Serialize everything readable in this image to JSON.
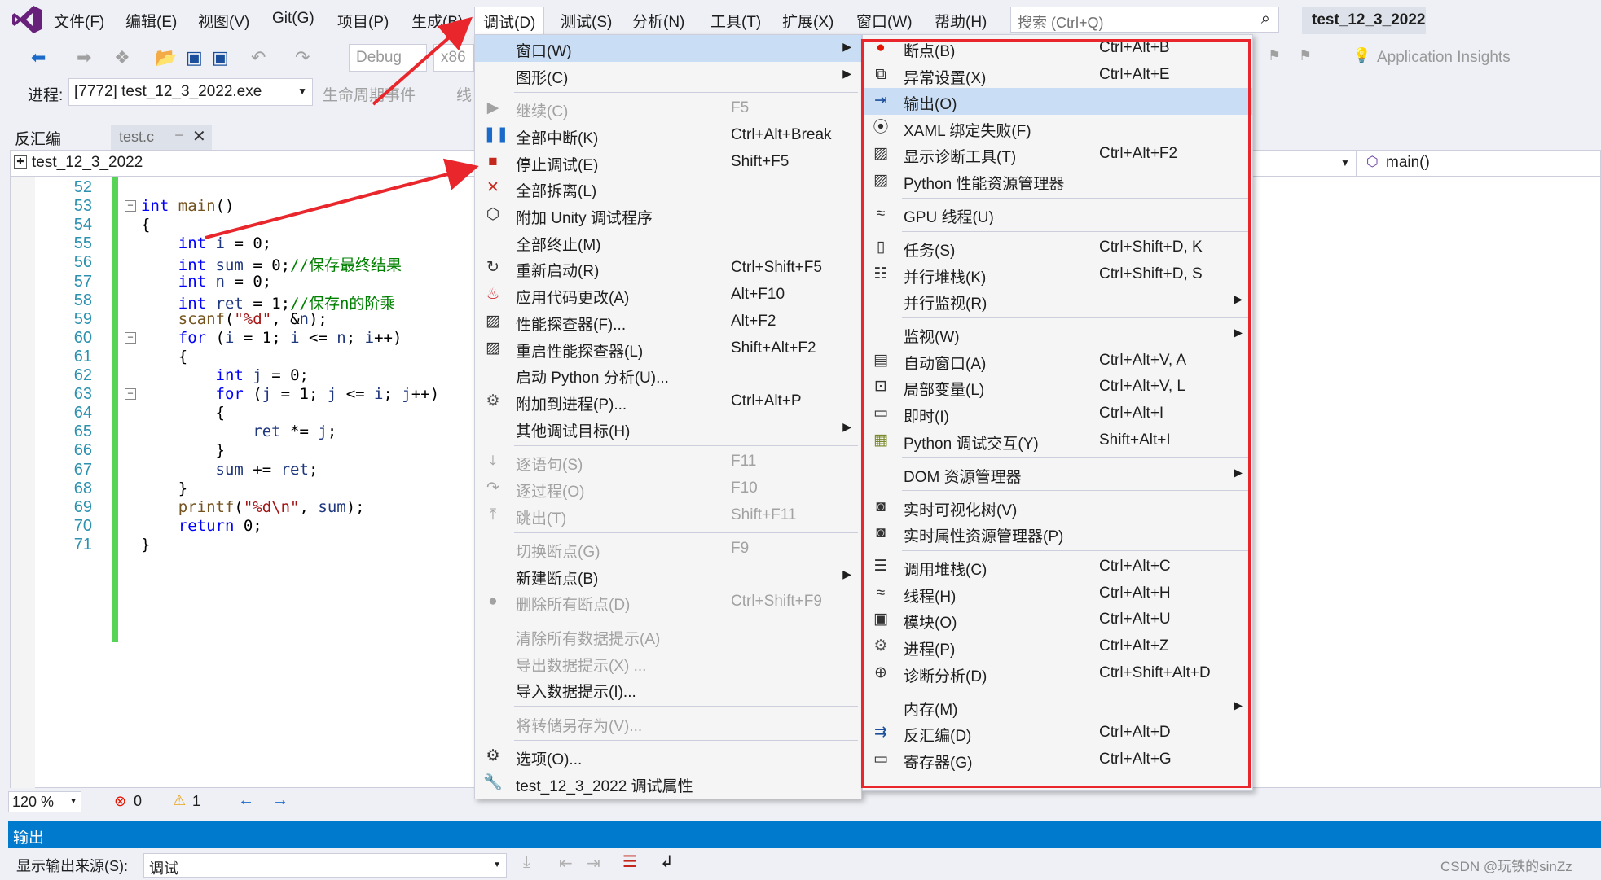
{
  "menubar": {
    "items": [
      "文件(F)",
      "编辑(E)",
      "视图(V)",
      "Git(G)",
      "项目(P)",
      "生成(B)",
      "调试(D)",
      "测试(S)",
      "分析(N)",
      "工具(T)",
      "扩展(X)",
      "窗口(W)",
      "帮助(H)"
    ],
    "search_placeholder": "搜索 (Ctrl+Q)",
    "solution_title": "test_12_3_2022"
  },
  "toolbar": {
    "config": "Debug",
    "platform": "x86",
    "insights": "Application Insights",
    "process_label": "进程:",
    "process_value": "[7772] test_12_3_2022.exe",
    "lifecycle": "生命周期事件",
    "thread": "线"
  },
  "tabs": {
    "disasm": "反汇编",
    "file": "test.c"
  },
  "navbar": {
    "project": "test_12_3_2022",
    "scope": "main()"
  },
  "code": [
    {
      "n": "52",
      "t": ""
    },
    {
      "n": "53",
      "t": "int main()"
    },
    {
      "n": "54",
      "t": "{"
    },
    {
      "n": "55",
      "t": "    int i = 0;"
    },
    {
      "n": "56",
      "t": "    int sum = 0;//保存最终结果"
    },
    {
      "n": "57",
      "t": "    int n = 0;"
    },
    {
      "n": "58",
      "t": "    int ret = 1;//保存n的阶乘"
    },
    {
      "n": "59",
      "t": "    scanf(\"%d\", &n);"
    },
    {
      "n": "60",
      "t": "    for (i = 1; i <= n; i++)"
    },
    {
      "n": "61",
      "t": "    {"
    },
    {
      "n": "62",
      "t": "        int j = 0;"
    },
    {
      "n": "63",
      "t": "        for (j = 1; j <= i; j++)"
    },
    {
      "n": "64",
      "t": "        {"
    },
    {
      "n": "65",
      "t": "            ret *= j;"
    },
    {
      "n": "66",
      "t": "        }"
    },
    {
      "n": "67",
      "t": "        sum += ret;"
    },
    {
      "n": "68",
      "t": "    }"
    },
    {
      "n": "69",
      "t": "    printf(\"%d\\n\", sum);"
    },
    {
      "n": "70",
      "t": "    return 0;"
    },
    {
      "n": "71",
      "t": "}"
    }
  ],
  "debug_menu": [
    {
      "icon": "",
      "label": "窗口(W)",
      "shortcut": "",
      "sub": true,
      "hl": true
    },
    {
      "icon": "",
      "label": "图形(C)",
      "shortcut": "",
      "sub": true
    },
    {
      "sep": true
    },
    {
      "icon": "play-icon",
      "label": "继续(C)",
      "shortcut": "F5",
      "dis": true
    },
    {
      "icon": "pause-icon",
      "label": "全部中断(K)",
      "shortcut": "Ctrl+Alt+Break"
    },
    {
      "icon": "stop-icon",
      "label": "停止调试(E)",
      "shortcut": "Shift+F5"
    },
    {
      "icon": "close-icon",
      "label": "全部拆离(L)",
      "shortcut": ""
    },
    {
      "icon": "unity-icon",
      "label": "附加 Unity 调试程序",
      "shortcut": ""
    },
    {
      "icon": "",
      "label": "全部终止(M)",
      "shortcut": ""
    },
    {
      "icon": "restart-icon",
      "label": "重新启动(R)",
      "shortcut": "Ctrl+Shift+F5"
    },
    {
      "icon": "fire-icon",
      "label": "应用代码更改(A)",
      "shortcut": "Alt+F10"
    },
    {
      "icon": "profiler-icon",
      "label": "性能探查器(F)...",
      "shortcut": "Alt+F2"
    },
    {
      "icon": "profiler-icon",
      "label": "重启性能探查器(L)",
      "shortcut": "Shift+Alt+F2"
    },
    {
      "icon": "",
      "label": "启动 Python 分析(U)...",
      "shortcut": ""
    },
    {
      "icon": "gears-icon",
      "label": "附加到进程(P)...",
      "shortcut": "Ctrl+Alt+P"
    },
    {
      "icon": "",
      "label": "其他调试目标(H)",
      "shortcut": "",
      "sub": true
    },
    {
      "sep": true
    },
    {
      "icon": "step-into-icon",
      "label": "逐语句(S)",
      "shortcut": "F11",
      "dis": true
    },
    {
      "icon": "step-over-icon",
      "label": "逐过程(O)",
      "shortcut": "F10",
      "dis": true
    },
    {
      "icon": "step-out-icon",
      "label": "跳出(T)",
      "shortcut": "Shift+F11",
      "dis": true
    },
    {
      "sep": true
    },
    {
      "icon": "",
      "label": "切换断点(G)",
      "shortcut": "F9",
      "dis": true
    },
    {
      "icon": "",
      "label": "新建断点(B)",
      "shortcut": "",
      "sub": true
    },
    {
      "icon": "breakpoints-icon",
      "label": "删除所有断点(D)",
      "shortcut": "Ctrl+Shift+F9",
      "dis": true
    },
    {
      "sep": true
    },
    {
      "icon": "",
      "label": "清除所有数据提示(A)",
      "shortcut": "",
      "dis": true
    },
    {
      "icon": "",
      "label": "导出数据提示(X) ...",
      "shortcut": "",
      "dis": true
    },
    {
      "icon": "",
      "label": "导入数据提示(I)...",
      "shortcut": ""
    },
    {
      "sep": true
    },
    {
      "icon": "",
      "label": "将转储另存为(V)...",
      "shortcut": "",
      "dis": true
    },
    {
      "sep": true
    },
    {
      "icon": "gear-icon",
      "label": "选项(O)...",
      "shortcut": ""
    },
    {
      "icon": "wrench-icon",
      "label": "test_12_3_2022 调试属性",
      "shortcut": ""
    }
  ],
  "window_menu": [
    {
      "icon": "breakpoint-icon",
      "label": "断点(B)",
      "shortcut": "Ctrl+Alt+B"
    },
    {
      "icon": "exception-icon",
      "label": "异常设置(X)",
      "shortcut": "Ctrl+Alt+E"
    },
    {
      "icon": "output-icon",
      "label": "输出(O)",
      "shortcut": "",
      "hl": true
    },
    {
      "icon": "xaml-icon",
      "label": "XAML 绑定失败(F)",
      "shortcut": ""
    },
    {
      "icon": "chart-icon",
      "label": "显示诊断工具(T)",
      "shortcut": "Ctrl+Alt+F2"
    },
    {
      "icon": "chart-icon",
      "label": "Python 性能资源管理器",
      "shortcut": ""
    },
    {
      "sep": true
    },
    {
      "icon": "gpu-icon",
      "label": "GPU 线程(U)",
      "shortcut": ""
    },
    {
      "sep": true
    },
    {
      "icon": "clipboard-icon",
      "label": "任务(S)",
      "shortcut": "Ctrl+Shift+D, K"
    },
    {
      "icon": "stack-icon",
      "label": "并行堆栈(K)",
      "shortcut": "Ctrl+Shift+D, S"
    },
    {
      "icon": "",
      "label": "并行监视(R)",
      "shortcut": "",
      "sub": true
    },
    {
      "sep": true
    },
    {
      "icon": "",
      "label": "监视(W)",
      "shortcut": "",
      "sub": true
    },
    {
      "icon": "autos-icon",
      "label": "自动窗口(A)",
      "shortcut": "Ctrl+Alt+V, A"
    },
    {
      "icon": "locals-icon",
      "label": "局部变量(L)",
      "shortcut": "Ctrl+Alt+V, L"
    },
    {
      "icon": "immediate-icon",
      "label": "即时(I)",
      "shortcut": "Ctrl+Alt+I"
    },
    {
      "icon": "python-icon",
      "label": "Python 调试交互(Y)",
      "shortcut": "Shift+Alt+I"
    },
    {
      "sep": true
    },
    {
      "icon": "",
      "label": "DOM 资源管理器",
      "shortcut": "",
      "sub": true
    },
    {
      "sep": true
    },
    {
      "icon": "camera-icon",
      "label": "实时可视化树(V)",
      "shortcut": ""
    },
    {
      "icon": "camera-icon",
      "label": "实时属性资源管理器(P)",
      "shortcut": ""
    },
    {
      "sep": true
    },
    {
      "icon": "callstack-icon",
      "label": "调用堆栈(C)",
      "shortcut": "Ctrl+Alt+C"
    },
    {
      "icon": "threads-icon",
      "label": "线程(H)",
      "shortcut": "Ctrl+Alt+H"
    },
    {
      "icon": "modules-icon",
      "label": "模块(O)",
      "shortcut": "Ctrl+Alt+U"
    },
    {
      "icon": "gears-icon",
      "label": "进程(P)",
      "shortcut": "Ctrl+Alt+Z"
    },
    {
      "icon": "diagnose-icon",
      "label": "诊断分析(D)",
      "shortcut": "Ctrl+Shift+Alt+D"
    },
    {
      "sep": true
    },
    {
      "icon": "",
      "label": "内存(M)",
      "shortcut": "",
      "sub": true
    },
    {
      "icon": "disasm-icon",
      "label": "反汇编(D)",
      "shortcut": "Ctrl+Alt+D"
    },
    {
      "icon": "register-icon",
      "label": "寄存器(G)",
      "shortcut": "Ctrl+Alt+G"
    }
  ],
  "statusbar": {
    "zoom": "120 %",
    "errors": "0",
    "warnings": "1"
  },
  "output": {
    "title": "输出",
    "source_label": "显示输出来源(S):",
    "source_value": "调试"
  },
  "watermark": "CSDN @玩铁的sinZz",
  "colors": {
    "accent": "#007acc",
    "highlight": "#c9def5",
    "annotation": "#e8262b"
  }
}
